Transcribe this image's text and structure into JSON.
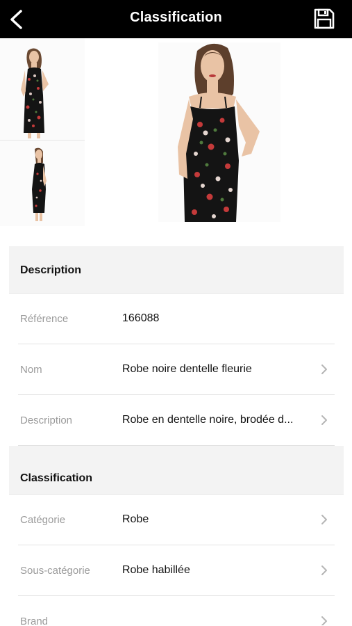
{
  "header": {
    "title": "Classification",
    "back_icon": "chevron-left-icon",
    "save_icon": "floppy-disk-icon"
  },
  "gallery": {
    "thumbnails": [
      "front-view-photo",
      "side-view-photo"
    ],
    "main": "front-view-photo"
  },
  "sections": {
    "description": {
      "title": "Description",
      "rows": [
        {
          "label": "Référence",
          "value": "166088"
        },
        {
          "label": "Nom",
          "value": "Robe noire dentelle fleurie"
        },
        {
          "label": "Description",
          "value": "Robe en dentelle noire, brodée d..."
        }
      ]
    },
    "classification": {
      "title": "Classification",
      "rows": [
        {
          "label": "Catégorie",
          "value": "Robe"
        },
        {
          "label": "Sous-catégorie",
          "value": "Robe habillée"
        },
        {
          "label": "Brand",
          "value": ""
        }
      ]
    }
  },
  "colors": {
    "header_bg": "#000000",
    "section_bg": "#f3f3f3",
    "label": "#9a9a9a",
    "chevron": "#b5b5b5"
  }
}
